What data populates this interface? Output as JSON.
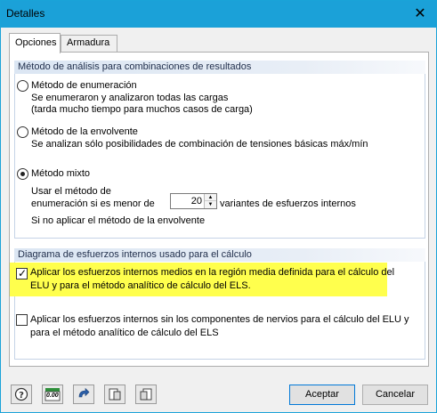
{
  "window": {
    "title": "Detalles",
    "close_glyph": "✕"
  },
  "tabs": [
    {
      "label": "Opciones",
      "active": true
    },
    {
      "label": "Armadura",
      "active": false
    }
  ],
  "section1": {
    "header": "Método de análisis para combinaciones de resultados",
    "options": [
      {
        "label": "Método de enumeración",
        "desc1": "Se enumeraron y analizaron todas las cargas",
        "desc2": "(tarda mucho tiempo para muchos casos de carga)",
        "checked": false
      },
      {
        "label": "Método de la envolvente",
        "desc1": "Se analizan sólo posibilidades de combinación de tensiones básicas máx/mín",
        "checked": false
      },
      {
        "label": "Método mixto",
        "checked": true
      }
    ],
    "mixed": {
      "line1": "Usar el método de",
      "line2": "enumeración si es menor de",
      "value": "20",
      "suffix": "variantes de esfuerzos internos",
      "else": "Si no aplicar el método de la envolvente"
    }
  },
  "section2": {
    "header": "Diagrama de esfuerzos internos usado para el cálculo",
    "check1": {
      "line1": "Aplicar los esfuerzos internos medios en la región media definida para el cálculo del",
      "line2": "ELU y para el método analítico de cálculo del ELS.",
      "checked": true
    },
    "check2": {
      "line1": "Aplicar los esfuerzos internos sin los componentes de nervios para el cálculo del ELU y",
      "line2": "para el método analítico de cálculo del ELS",
      "checked": false
    }
  },
  "toolbar": {
    "icons": [
      "help-icon",
      "units-icon",
      "redo-icon",
      "export-icon",
      "import-icon"
    ],
    "units_label": "0.00"
  },
  "buttons": {
    "ok": "Aceptar",
    "cancel": "Cancelar"
  },
  "colors": {
    "titlebar": "#1ba1d8",
    "highlight": "#ffff4d",
    "header_gradient": "#dbe6f3"
  }
}
